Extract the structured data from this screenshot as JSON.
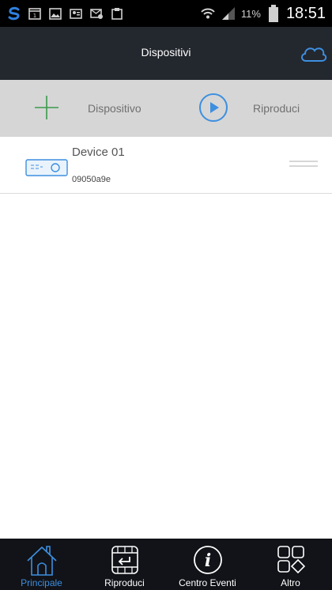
{
  "status_bar": {
    "left_icons": [
      "app-s-icon",
      "calendar-icon",
      "gallery-icon",
      "contacts-icon",
      "sms-icon",
      "clipboard-icon"
    ],
    "battery_percent": "11%",
    "time": "18:51"
  },
  "header": {
    "title": "Dispositivi",
    "cloud_icon": "cloud-icon"
  },
  "toolbar": {
    "add_label": "Dispositivo",
    "play_label": "Riproduci",
    "add_color": "#3a9a4a",
    "play_color": "#3d8fe0"
  },
  "devices": [
    {
      "name": "Device 01",
      "id": "09050a9e"
    }
  ],
  "bottom_nav": {
    "items": [
      {
        "label": "Principale",
        "icon": "home-icon",
        "active": true
      },
      {
        "label": "Riproduci",
        "icon": "playback-icon",
        "active": false
      },
      {
        "label": "Centro Eventi",
        "icon": "info-icon",
        "active": false
      },
      {
        "label": "Altro",
        "icon": "more-icon",
        "active": false
      }
    ]
  },
  "colors": {
    "accent": "#3d8fe0",
    "header_bg": "#23272e",
    "toolbar_bg": "#d6d6d6",
    "nav_bg": "#111318"
  }
}
